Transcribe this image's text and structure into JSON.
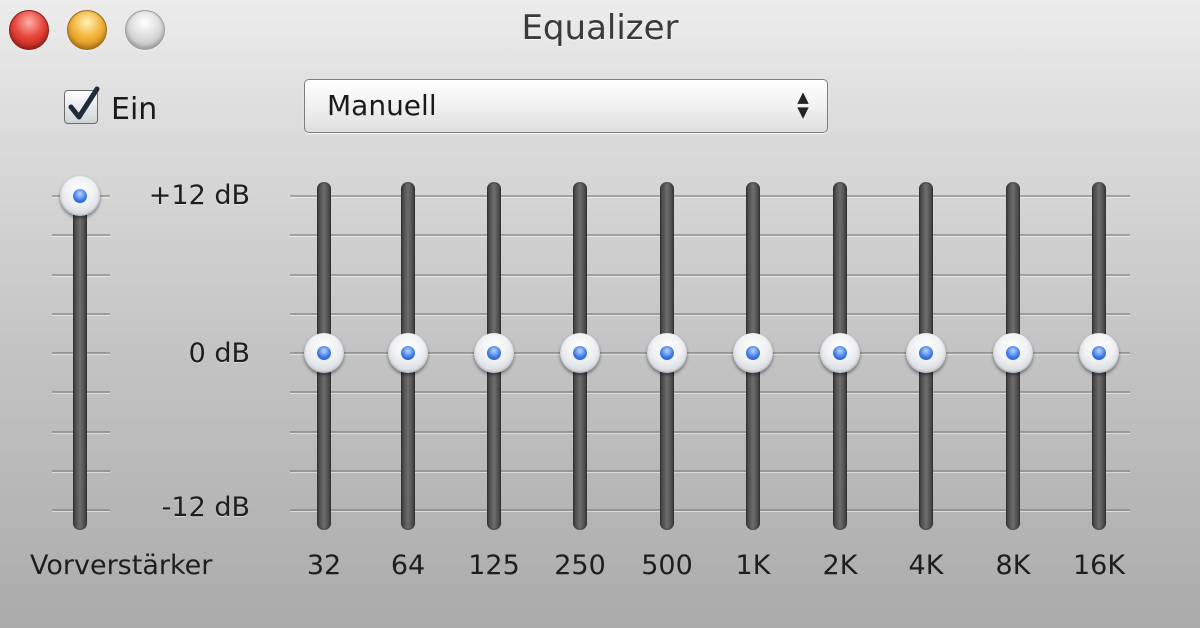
{
  "window": {
    "title": "Equalizer"
  },
  "controls": {
    "enabled": true,
    "enabled_label": "Ein",
    "preset_value": "Manuell"
  },
  "scale": {
    "max_label": "+12 dB",
    "mid_label": "0 dB",
    "min_label": "-12 dB",
    "max_db": 12,
    "min_db": -12
  },
  "preamp": {
    "label": "Vorverstärker",
    "value_db": 12
  },
  "bands": [
    {
      "label": "32",
      "value_db": 0
    },
    {
      "label": "64",
      "value_db": 0
    },
    {
      "label": "125",
      "value_db": 0
    },
    {
      "label": "250",
      "value_db": 0
    },
    {
      "label": "500",
      "value_db": 0
    },
    {
      "label": "1K",
      "value_db": 0
    },
    {
      "label": "2K",
      "value_db": 0
    },
    {
      "label": "4K",
      "value_db": 0
    },
    {
      "label": "8K",
      "value_db": 0
    },
    {
      "label": "16K",
      "value_db": 0
    }
  ],
  "icons": {
    "close": "close-button-red",
    "minimize": "minimize-button-yellow",
    "zoom": "zoom-button-gray",
    "checkmark": "checkmark-icon",
    "updown": "up-down-arrows-icon"
  },
  "colors": {
    "knob_accent": "#3d7ae8",
    "close": "#e8473c",
    "minimize": "#f4b43c"
  }
}
